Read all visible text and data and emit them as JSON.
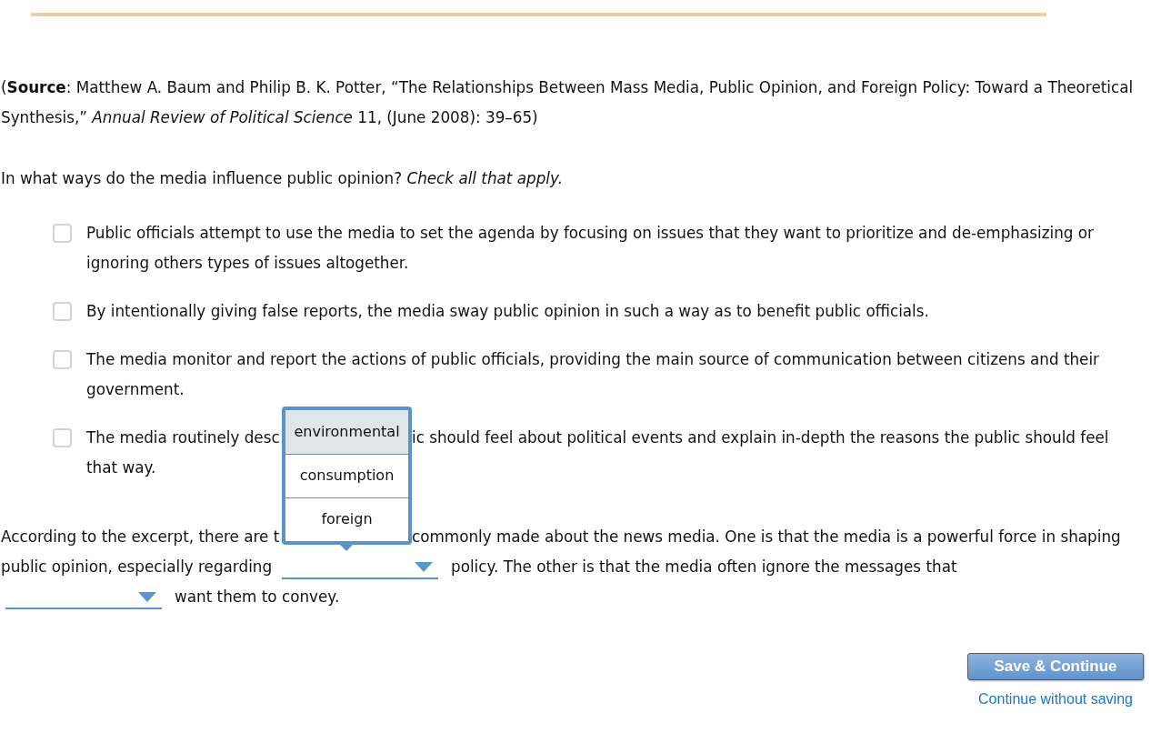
{
  "source": "(**Source**: Matthew A. Baum and Philip B. K. Potter, “The Relationships Between Mass Media, Public Opinion, and Foreign Policy: Toward a Theoretical Synthesis,” *Annual Review of Political Science* 11, (June 2008): 39–65)",
  "question": "In what ways do the media influence public opinion? *Check all that apply.*",
  "options": [
    {
      "lines": [
        [
          {
            "kind": "text",
            "text": "Public officials attempt to use the media to set the agenda by focusing on issues that they want to prioritize and de-emphasizing or ignoring others types of issues altogether."
          }
        ]
      ],
      "checked": false
    },
    {
      "lines": [
        [
          {
            "kind": "text",
            "text": "By intentionally giving false reports, the media sway public opinion in such a way as to benefit public officials."
          }
        ]
      ],
      "checked": false
    },
    {
      "lines": [
        [
          {
            "kind": "text",
            "text": "The media monitor and report the actions of public officials, providing the main source of communication between citizens and their government."
          }
        ]
      ],
      "checked": false
    },
    {
      "lines": [
        [
          {
            "kind": "text",
            "text": "The media routinely desc"
          },
          {
            "kind": "covered"
          },
          {
            "kind": "text",
            "text": "ic should feel about political events and explain in-depth the reasons the public should feel"
          }
        ],
        [
          {
            "kind": "text",
            "text": "that way."
          }
        ]
      ],
      "checked": false
    }
  ],
  "completion": {
    "lines": [
      [
        {
          "kind": "text",
          "text": "According to the excerpt, there are t"
        },
        {
          "kind": "covered"
        },
        {
          "kind": "text",
          "text": "commonly made about the news media. One is that the media is a powerful force in shaping"
        }
      ],
      [
        {
          "kind": "text",
          "text": "public opinion, especially regarding"
        },
        {
          "kind": "blank",
          "expanded": true,
          "choices": [
            {
              "text": "environmental",
              "selected": true
            },
            {
              "text": "consumption",
              "selected": false
            },
            {
              "text": "foreign",
              "selected": false
            }
          ]
        },
        {
          "kind": "text",
          "text": "policy. The other is that the media often ignore the messages that"
        }
      ],
      [
        {
          "kind": "blank",
          "expanded": false
        },
        {
          "kind": "text",
          "text": "want them to convey."
        }
      ]
    ]
  },
  "buttons": {
    "primary": "Save & Continue",
    "secondary": "Continue without saving"
  }
}
